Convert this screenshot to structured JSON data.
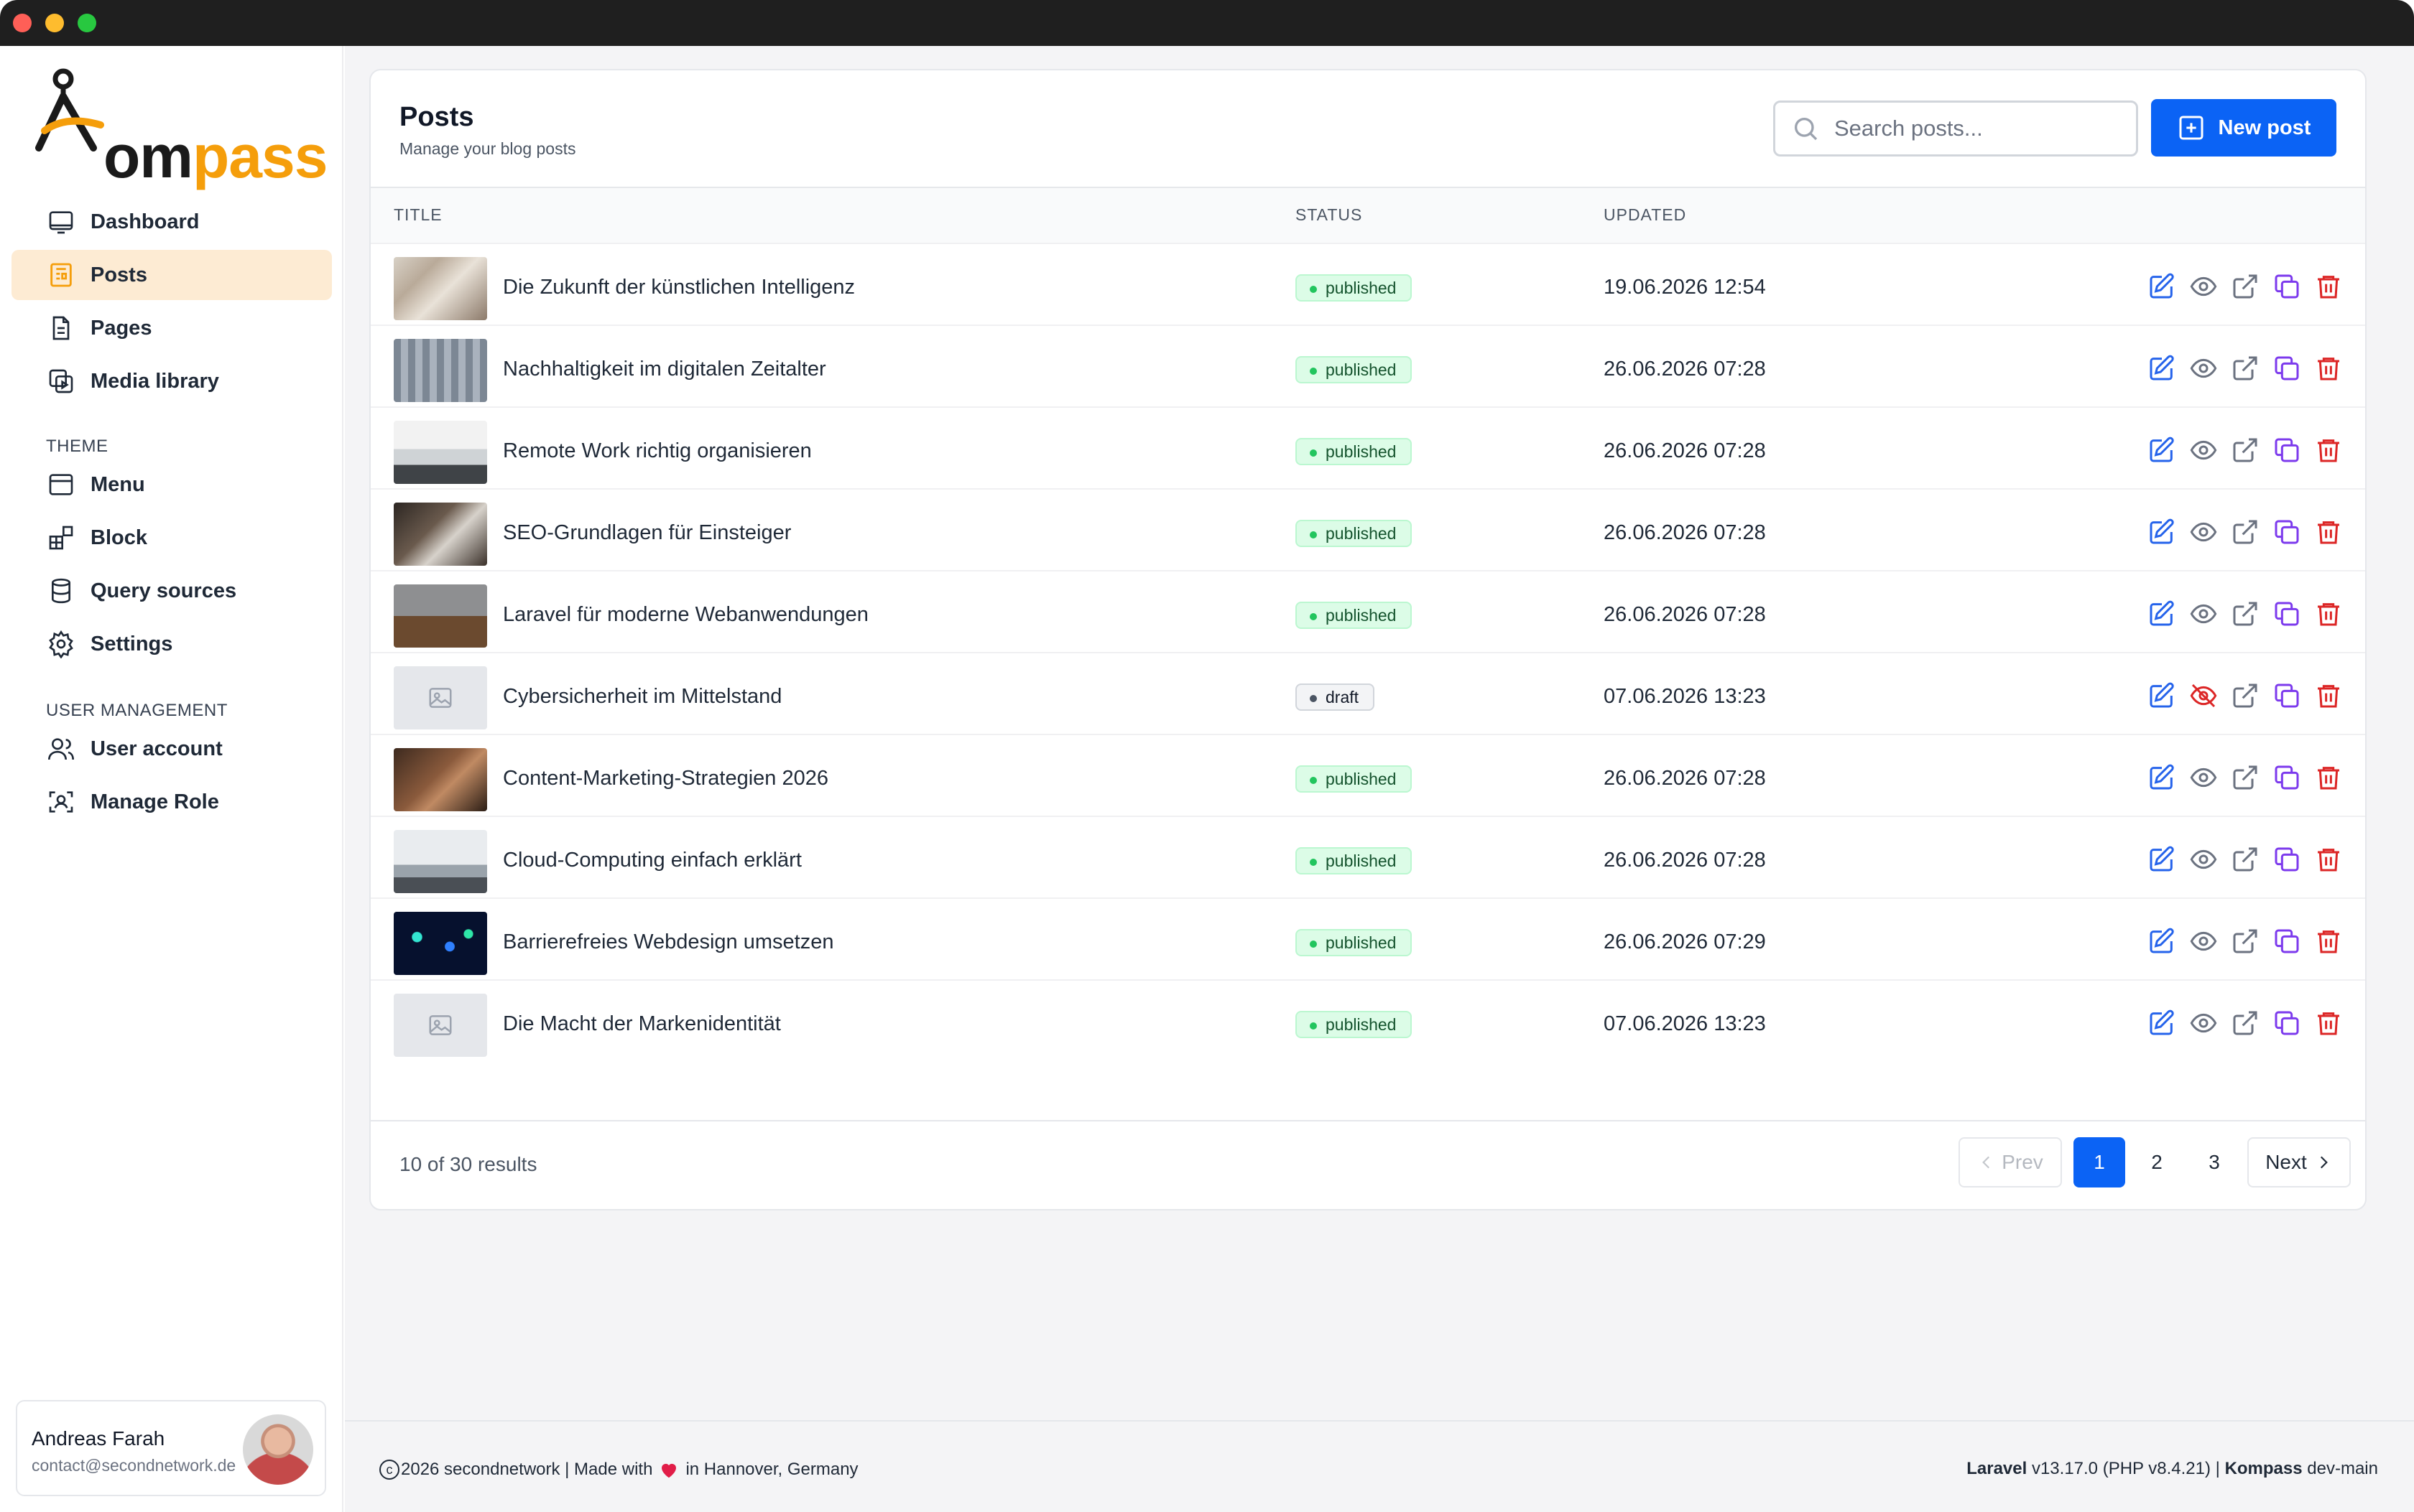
{
  "app": {
    "logo": {
      "prefix": "om",
      "suffix": "pass"
    }
  },
  "sidebar": {
    "main_items": [
      {
        "label": "Dashboard",
        "icon": "monitor-icon"
      },
      {
        "label": "Posts",
        "icon": "newspaper-icon",
        "active": true
      },
      {
        "label": "Pages",
        "icon": "document-icon"
      },
      {
        "label": "Media library",
        "icon": "media-icon"
      }
    ],
    "theme_label": "THEME",
    "theme_items": [
      {
        "label": "Menu",
        "icon": "window-icon"
      },
      {
        "label": "Block",
        "icon": "blocks-icon"
      },
      {
        "label": "Query sources",
        "icon": "database-icon"
      },
      {
        "label": "Settings",
        "icon": "gear-icon"
      }
    ],
    "user_mgmt_label": "USER MANAGEMENT",
    "user_mgmt_items": [
      {
        "label": "User account",
        "icon": "users-icon"
      },
      {
        "label": "Manage Role",
        "icon": "face-scan-icon"
      }
    ],
    "user": {
      "name": "Andreas Farah",
      "email": "contact@secondnetwork.de"
    }
  },
  "header": {
    "title": "Posts",
    "subtitle": "Manage your blog posts",
    "search_placeholder": "Search posts...",
    "new_button": "New post"
  },
  "table": {
    "columns": [
      "TITLE",
      "STATUS",
      "UPDATED"
    ],
    "rows": [
      {
        "title": "Die Zukunft der künstlichen Intelligenz",
        "status": "published",
        "updated": "19.06.2026 12:54",
        "thumb": "photo-people"
      },
      {
        "title": "Nachhaltigkeit im digitalen Zeitalter",
        "status": "published",
        "updated": "26.06.2026 07:28",
        "thumb": "photo-seats"
      },
      {
        "title": "Remote Work richtig organisieren",
        "status": "published",
        "updated": "26.06.2026 07:28",
        "thumb": "photo-office"
      },
      {
        "title": "SEO-Grundlagen für Einsteiger",
        "status": "published",
        "updated": "26.06.2026 07:28",
        "thumb": "photo-laptop"
      },
      {
        "title": "Laravel für moderne Webanwendungen",
        "status": "published",
        "updated": "26.06.2026 07:28",
        "thumb": "photo-desk"
      },
      {
        "title": "Cybersicherheit im Mittelstand",
        "status": "draft",
        "updated": "07.06.2026 13:23",
        "thumb": "placeholder"
      },
      {
        "title": "Content-Marketing-Strategien 2026",
        "status": "published",
        "updated": "26.06.2026 07:28",
        "thumb": "photo-meeting"
      },
      {
        "title": "Cloud-Computing einfach erklärt",
        "status": "published",
        "updated": "26.06.2026 07:28",
        "thumb": "photo-room"
      },
      {
        "title": "Barrierefreies Webdesign umsetzen",
        "status": "published",
        "updated": "26.06.2026 07:29",
        "thumb": "photo-lights"
      },
      {
        "title": "Die Macht der Markenidentität",
        "status": "published",
        "updated": "07.06.2026 13:23",
        "thumb": "placeholder"
      }
    ]
  },
  "pagination": {
    "summary": "10 of 30 results",
    "prev": "Prev",
    "pages": [
      "1",
      "2",
      "3"
    ],
    "current": "1",
    "next": "Next"
  },
  "footer": {
    "left_pre": "2026 secondnetwork | Made with",
    "left_post": "in Hannover, Germany",
    "laravel": "Laravel",
    "laravel_ver": "v13.17.0 (PHP v8.4.21) |",
    "kompass": "Kompass",
    "kompass_ver": "dev-main"
  },
  "colors": {
    "accent": "#0b63f5",
    "brand_orange": "#f59e0b",
    "active_nav_bg": "#fdebd3",
    "edit_icon": "#2563eb",
    "view_icon": "#6b7280",
    "hidden_icon": "#dc2626",
    "duplicate_icon": "#7c3aed",
    "delete_icon": "#dc2626"
  }
}
